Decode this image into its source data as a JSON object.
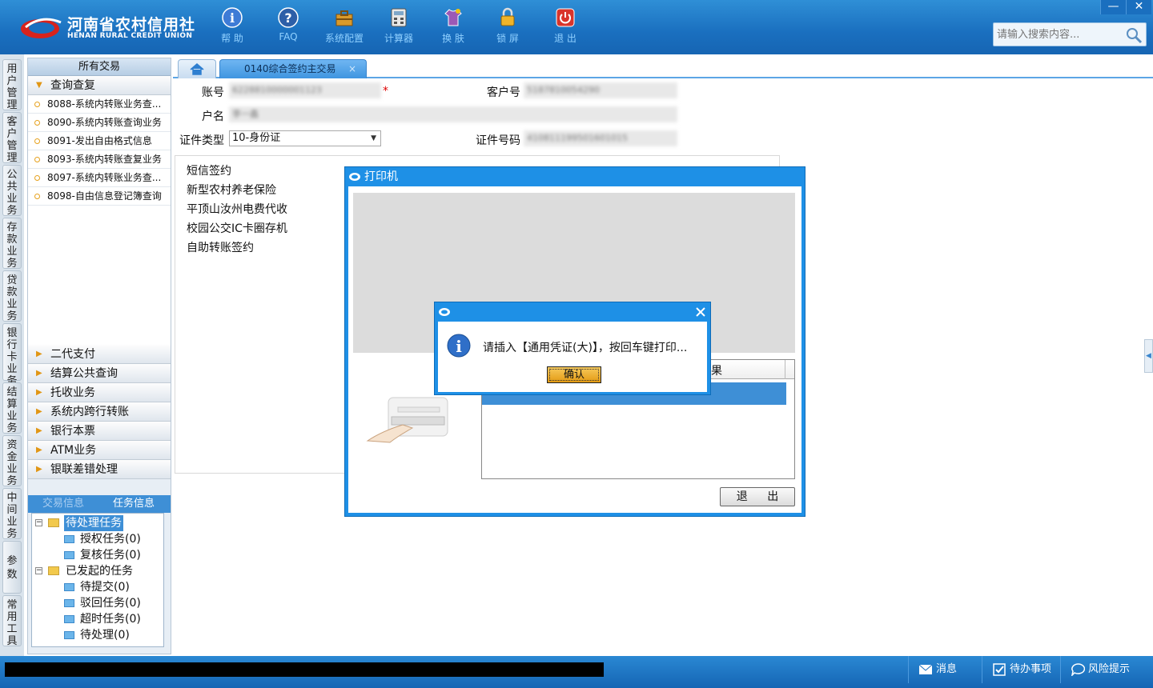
{
  "app": {
    "logo_cn": "河南省农村信用社",
    "logo_en": "HENAN RURAL CREDIT UNION",
    "toolbar": [
      {
        "label": "帮 助",
        "icon": "info-icon"
      },
      {
        "label": "FAQ",
        "icon": "question-icon"
      },
      {
        "label": "系统配置",
        "icon": "toolbox-icon"
      },
      {
        "label": "计算器",
        "icon": "calculator-icon"
      },
      {
        "label": "换 肤",
        "icon": "shirt-icon"
      },
      {
        "label": "锁 屏",
        "icon": "lock-icon"
      },
      {
        "label": "退 出",
        "icon": "power-icon"
      }
    ],
    "window": {
      "minimize": "—",
      "close": "✕"
    },
    "search": {
      "placeholder": "请输入搜索内容..."
    }
  },
  "left_nav": [
    "用户管理",
    "客户管理",
    "公共业务",
    "存款业务",
    "贷款业务",
    "银行卡业务",
    "结算业务",
    "资金业务",
    "中间业务",
    "参数",
    "常用工具"
  ],
  "sidebar": {
    "header": "所有交易",
    "open_group": "查询查复",
    "open_items": [
      "8088-系统内转账业务查...",
      "8090-系统内转账查询业务",
      "8091-发出自由格式信息",
      "8093-系统内转账查复业务",
      "8097-系统内转账业务查...",
      "8098-自由信息登记簿查询"
    ],
    "groups": [
      "二代支付",
      "结算公共查询",
      "托收业务",
      "系统内跨行转账",
      "银行本票",
      "ATM业务",
      "银联差错处理"
    ],
    "bottom_tabs": [
      "交易信息",
      "任务信息"
    ],
    "tree": {
      "pending": "待处理任务",
      "pending_children": [
        "授权任务(0)",
        "复核任务(0)"
      ],
      "initiated": "已发起的任务",
      "initiated_children": [
        "待提交(0)",
        "驳回任务(0)",
        "超时任务(0)",
        "待处理(0)"
      ]
    }
  },
  "main": {
    "tab_label": "0140综合签约主交易",
    "tab_close": "×",
    "form": {
      "account_label": "账号",
      "account_value": "6228810000001123",
      "required": "*",
      "customer_no_label": "客户号",
      "customer_no_value": "5187810054290",
      "name_label": "户名",
      "name_value": "李一鑫",
      "id_type_label": "证件类型",
      "id_type_value": "10-身份证",
      "id_no_label": "证件号码",
      "id_no_value": "410811199501601015"
    },
    "services": [
      "短信签约",
      "新型农村养老保险",
      "平顶山汝州电费代收",
      "校园公交IC卡圈存机",
      "自助转账签约"
    ]
  },
  "printer_dialog": {
    "title": "打印机",
    "column_fragment": "果",
    "exit_button": "退 出"
  },
  "alert": {
    "message": "请插入【通用凭证(大)】，按回车键打印...",
    "ok_button": "确认"
  },
  "status": {
    "items": [
      {
        "label": "消息",
        "icon": "envelope-icon"
      },
      {
        "label": "待办事项",
        "icon": "checkbox-icon"
      },
      {
        "label": "风险提示",
        "icon": "chat-bubble-icon"
      }
    ]
  },
  "colors": {
    "accent": "#1e90e6",
    "header": "#1a6fbf",
    "highlight": "#3e8fd6"
  }
}
